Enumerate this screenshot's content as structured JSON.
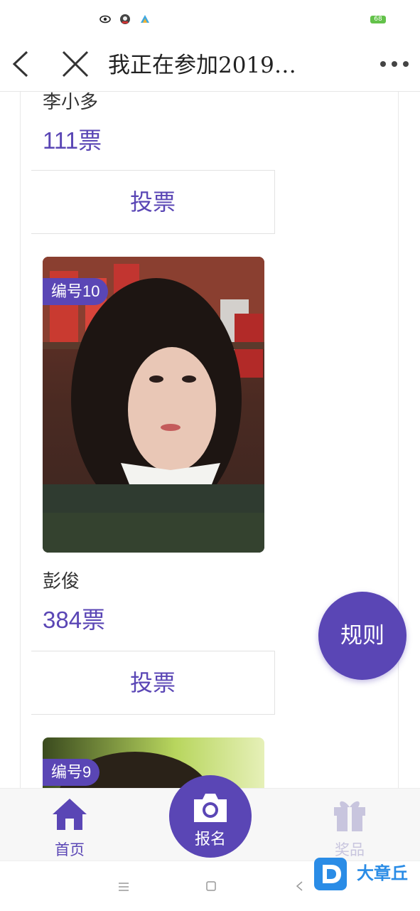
{
  "status_bar": {
    "battery": "68",
    "icons": [
      "eye-app-icon",
      "avatar-app-icon",
      "maps-app-icon"
    ]
  },
  "nav": {
    "title": "我正在参加2019…",
    "back_icon": "chevron-left-icon",
    "close_icon": "close-icon",
    "more_icon": "more-dots-icon"
  },
  "entries": [
    {
      "name": "李小多",
      "votes": "111票",
      "vote_label": "投票"
    },
    {
      "badge": "编号10",
      "name": "彭俊",
      "votes": "384票",
      "vote_label": "投票"
    },
    {
      "badge": "编号9"
    }
  ],
  "rules_button": "规则",
  "tabbar": {
    "home": {
      "label": "首页",
      "icon": "home-icon"
    },
    "signup": {
      "label": "报名",
      "icon": "camera-icon"
    },
    "prizes": {
      "label": "奖品",
      "icon": "gift-icon"
    }
  },
  "watermark": "大章丘",
  "colors": {
    "accent": "#5a46b5",
    "inactive": "#c8c5de",
    "text": "#333333"
  }
}
